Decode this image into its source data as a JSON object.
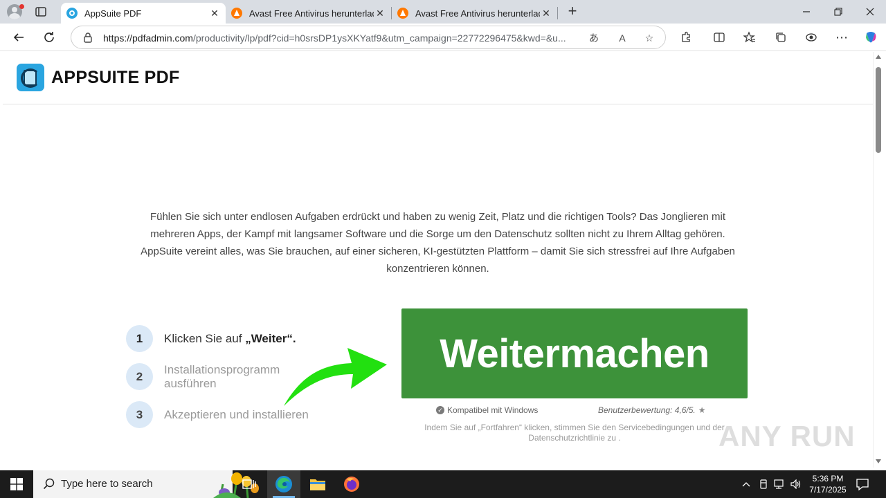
{
  "browser": {
    "tabs": [
      {
        "title": "AppSuite PDF",
        "favicon": "appsuite-favicon",
        "active": true
      },
      {
        "title": "Avast Free Antivirus herunterladen",
        "favicon": "avast-favicon",
        "active": false
      },
      {
        "title": "Avast Free Antivirus herunterladen",
        "favicon": "avast-favicon",
        "active": false
      }
    ],
    "url_host": "https://pdfadmin.com",
    "url_rest": "/productivity/lp/pdf?cid=h0srsDP1ysXKYatf9&utm_campaign=22772296475&kwd=&u..."
  },
  "page": {
    "brand_name": "APPSUITE PDF",
    "intro_text": "Fühlen Sie sich unter endlosen Aufgaben erdrückt und haben zu wenig Zeit, Platz und die richtigen Tools? Das Jonglieren mit mehreren Apps, der Kampf mit langsamer Software und die Sorge um den Datenschutz sollten nicht zu Ihrem Alltag gehören. AppSuite vereint alles, was Sie brauchen, auf einer sicheren, KI-gestützten Plattform – damit Sie sich stressfrei auf Ihre Aufgaben konzentrieren können.",
    "steps": [
      {
        "num": "1",
        "text_prefix": "Klicken Sie auf ",
        "text_bold": "„Weiter“."
      },
      {
        "num": "2",
        "text": "Installationsprogramm ausführen"
      },
      {
        "num": "3",
        "text": "Akzeptieren und installieren"
      }
    ],
    "cta_label": "Weitermachen",
    "compat_label": "Kompatibel mit Windows",
    "rating_label": "Benutzerbewertung: 4,6/5.",
    "terms_text": "Indem Sie auf „Fortfahren“ klicken, stimmen Sie den Servicebedingungen und der Datenschutzrichtlinie zu .",
    "cta_color": "#3d923a",
    "arrow_color": "#22e010"
  },
  "watermark": "ANY RUN",
  "taskbar": {
    "search_placeholder": "Type here to search",
    "time": "5:36 PM",
    "date": "7/17/2025"
  }
}
